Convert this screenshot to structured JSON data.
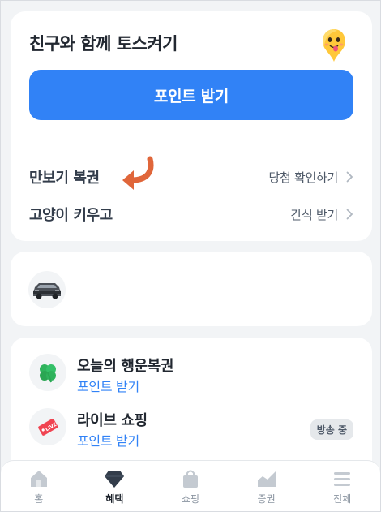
{
  "invite": {
    "title": "친구와 함께 토스켜기",
    "button_label": "포인트 받기"
  },
  "rows": [
    {
      "label": "만보기 복권",
      "action": "당첨 확인하기"
    },
    {
      "label": "고양이 키우고",
      "action": "간식 받기"
    }
  ],
  "benefits": [
    {
      "title": "오늘의 행운복권",
      "subtitle": "포인트 받기",
      "icon": "clover-icon"
    },
    {
      "title": "라이브 쇼핑",
      "subtitle": "포인트 받기",
      "icon": "live-tag-icon",
      "badge": "방송 중"
    }
  ],
  "tabs": [
    {
      "label": "홈",
      "icon": "home-icon",
      "active": false
    },
    {
      "label": "혜택",
      "icon": "gem-icon",
      "active": true
    },
    {
      "label": "쇼핑",
      "icon": "shopping-bag-icon",
      "active": false
    },
    {
      "label": "증권",
      "icon": "chart-icon",
      "active": false
    },
    {
      "label": "전체",
      "icon": "menu-icon",
      "active": false
    }
  ],
  "colors": {
    "accent": "#3182f6",
    "background": "#f2f4f6",
    "arrow": "#e0663a"
  }
}
